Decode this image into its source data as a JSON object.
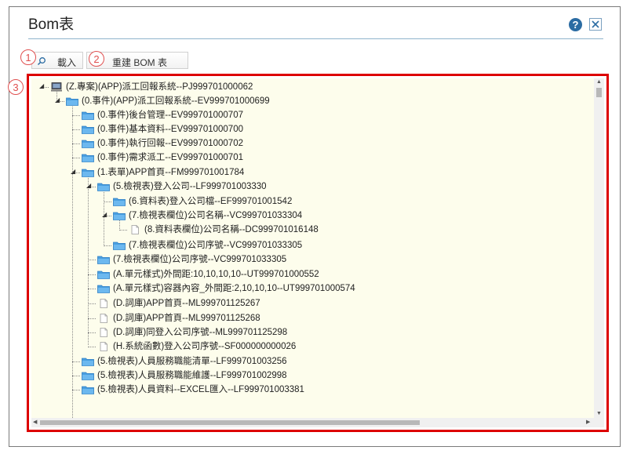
{
  "dialog": {
    "title": "Bom表",
    "help_label": "?"
  },
  "toolbar": {
    "load_label": "載入",
    "rebuild_label": "重建 BOM 表"
  },
  "badges": [
    "1",
    "2",
    "3"
  ],
  "colors": {
    "accent": "#2b6ca3",
    "highlight_border": "#dd0000",
    "tree_bg": "#fdfdec",
    "folder": "#4a9fe0"
  },
  "tree": {
    "nodes": [
      {
        "label": "(Z.專案)(APP)派工回報系統--PJ999701000062",
        "icon": "computer-icon",
        "expanded": true
      },
      {
        "label": "(0.事件)(APP)派工回報系統--EV999701000699",
        "icon": "folder-icon",
        "expanded": true
      },
      {
        "label": "(0.事件)後台管理--EV999701000707",
        "icon": "folder-icon"
      },
      {
        "label": "(0.事件)基本資料--EV999701000700",
        "icon": "folder-icon"
      },
      {
        "label": "(0.事件)執行回報--EV999701000702",
        "icon": "folder-icon"
      },
      {
        "label": "(0.事件)需求派工--EV999701000701",
        "icon": "folder-icon"
      },
      {
        "label": "(1.表單)APP首頁--FM999701001784",
        "icon": "folder-icon",
        "expanded": true
      },
      {
        "label": "(5.檢視表)登入公司--LF999701003330",
        "icon": "folder-icon",
        "expanded": true
      },
      {
        "label": "(6.資料表)登入公司檔--EF999701001542",
        "icon": "folder-icon"
      },
      {
        "label": "(7.檢視表欄位)公司名稱--VC999701033304",
        "icon": "folder-icon",
        "expanded": true
      },
      {
        "label": "(8.資料表欄位)公司名稱--DC999701016148",
        "icon": "document-icon"
      },
      {
        "label": "(7.檢視表欄位)公司序號--VC999701033305",
        "icon": "folder-icon"
      },
      {
        "label": "(7.檢視表欄位)公司序號--VC999701033305",
        "icon": "folder-icon"
      },
      {
        "label": "(A.單元樣式)外間距:10,10,10,10--UT999701000552",
        "icon": "folder-icon"
      },
      {
        "label": "(A.單元樣式)容器內容_外間距:2,10,10,10--UT999701000574",
        "icon": "folder-icon"
      },
      {
        "label": "(D.詞庫)APP首頁--ML999701125267",
        "icon": "document-icon"
      },
      {
        "label": "(D.詞庫)APP首頁--ML999701125268",
        "icon": "document-icon"
      },
      {
        "label": "(D.詞庫)同登入公司序號--ML999701125298",
        "icon": "document-icon"
      },
      {
        "label": "(H.系統函數)登入公司序號--SF000000000026",
        "icon": "document-icon"
      },
      {
        "label": "(5.檢視表)人員服務職能清單--LF999701003256",
        "icon": "folder-icon"
      },
      {
        "label": "(5.檢視表)人員服務職能維護--LF999701002998",
        "icon": "folder-icon"
      },
      {
        "label": "(5.檢視表)人員資料--EXCEL匯入--LF999701003381",
        "icon": "folder-icon"
      }
    ]
  }
}
